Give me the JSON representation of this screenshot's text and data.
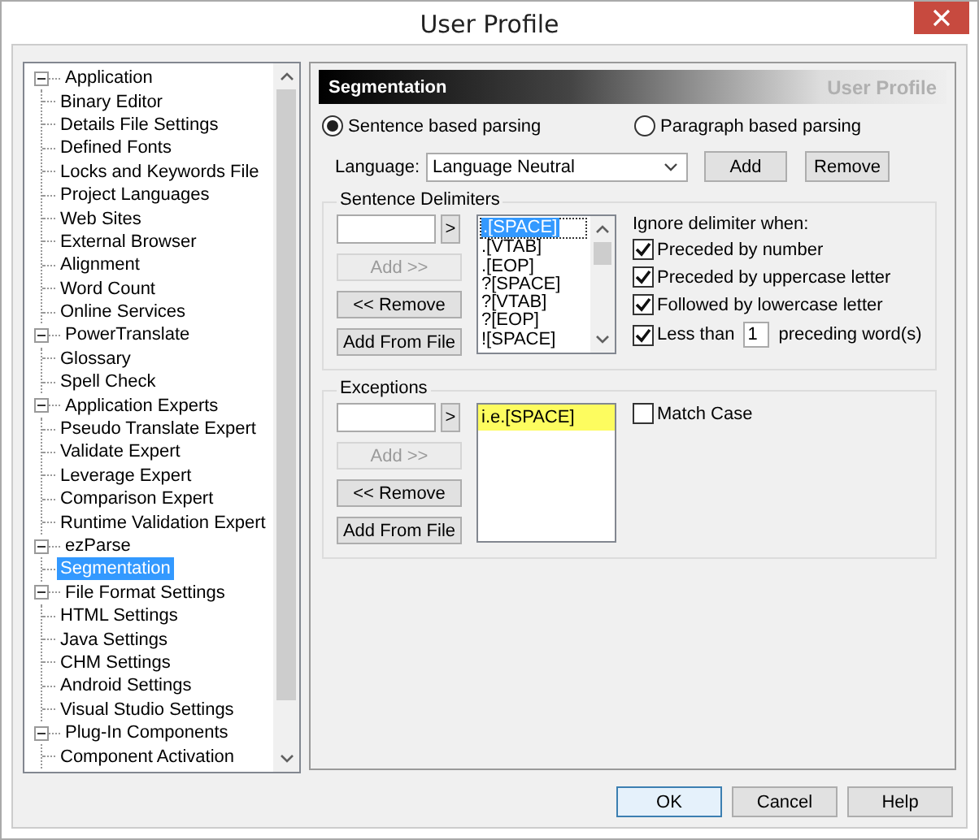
{
  "window": {
    "title": "User Profile"
  },
  "tree": {
    "items": [
      {
        "label": "Application",
        "expanded": true,
        "selected": false,
        "children": [
          {
            "label": "Binary Editor",
            "selected": false
          },
          {
            "label": "Details File Settings",
            "selected": false
          },
          {
            "label": "Defined Fonts",
            "selected": false
          },
          {
            "label": "Locks and Keywords File",
            "selected": false
          },
          {
            "label": "Project Languages",
            "selected": false
          },
          {
            "label": "Web Sites",
            "selected": false
          },
          {
            "label": "External Browser",
            "selected": false
          },
          {
            "label": "Alignment",
            "selected": false
          },
          {
            "label": "Word Count",
            "selected": false
          },
          {
            "label": "Online Services",
            "selected": false
          }
        ]
      },
      {
        "label": "PowerTranslate",
        "expanded": true,
        "selected": false,
        "children": [
          {
            "label": "Glossary",
            "selected": false
          },
          {
            "label": "Spell Check",
            "selected": false
          }
        ]
      },
      {
        "label": "Application Experts",
        "expanded": true,
        "selected": false,
        "children": [
          {
            "label": "Pseudo Translate Expert",
            "selected": false
          },
          {
            "label": "Validate Expert",
            "selected": false
          },
          {
            "label": "Leverage Expert",
            "selected": false
          },
          {
            "label": "Comparison Expert",
            "selected": false
          },
          {
            "label": "Runtime Validation Expert",
            "selected": false
          }
        ]
      },
      {
        "label": "ezParse",
        "expanded": true,
        "selected": false,
        "children": [
          {
            "label": "Segmentation",
            "selected": true
          }
        ]
      },
      {
        "label": "File Format Settings",
        "expanded": true,
        "selected": false,
        "children": [
          {
            "label": "HTML Settings",
            "selected": false
          },
          {
            "label": "Java Settings",
            "selected": false
          },
          {
            "label": "CHM Settings",
            "selected": false
          },
          {
            "label": "Android Settings",
            "selected": false
          },
          {
            "label": "Visual Studio Settings",
            "selected": false
          }
        ]
      },
      {
        "label": "Plug-In Components",
        "expanded": true,
        "selected": false,
        "children": [
          {
            "label": "Component Activation",
            "selected": false
          }
        ]
      }
    ]
  },
  "panel": {
    "title": "Segmentation",
    "subtitle": "User Profile",
    "parsing": [
      {
        "label": "Sentence based parsing",
        "selected": true
      },
      {
        "label": "Paragraph based parsing",
        "selected": false
      }
    ],
    "language": {
      "label": "Language:",
      "value": "Language Neutral",
      "buttons": [
        "Add",
        "Remove"
      ]
    },
    "groups": [
      {
        "title": "Sentence Delimiters",
        "arrow": ">",
        "buttons": [
          {
            "label": "Add >>",
            "disabled": true
          },
          {
            "label": "<< Remove",
            "disabled": false
          },
          {
            "label": "Add From File",
            "disabled": false
          }
        ],
        "list": [
          {
            "text": ".[SPACE]",
            "selected": true,
            "highlighted": false
          },
          {
            "text": ".[VTAB]",
            "selected": false,
            "highlighted": false
          },
          {
            "text": ".[EOP]",
            "selected": false,
            "highlighted": false
          },
          {
            "text": "?[SPACE]",
            "selected": false,
            "highlighted": false
          },
          {
            "text": "?[VTAB]",
            "selected": false,
            "highlighted": false
          },
          {
            "text": "?[EOP]",
            "selected": false,
            "highlighted": false
          },
          {
            "text": "![SPACE]",
            "selected": false,
            "highlighted": false
          }
        ],
        "scrollable": true,
        "options_label": "Ignore delimiter when:",
        "options": [
          {
            "kind": "check",
            "label": "Preceded by number",
            "checked": true
          },
          {
            "kind": "check",
            "label": "Preceded by uppercase letter",
            "checked": true
          },
          {
            "kind": "check",
            "label": "Followed by lowercase letter",
            "checked": true
          },
          {
            "kind": "count",
            "label": "Less than",
            "checked": true,
            "value": "1",
            "suffix": "preceding word(s)"
          }
        ]
      },
      {
        "title": "Exceptions",
        "arrow": ">",
        "buttons": [
          {
            "label": "Add >>",
            "disabled": true
          },
          {
            "label": "<< Remove",
            "disabled": false
          },
          {
            "label": "Add From File",
            "disabled": false
          }
        ],
        "list": [
          {
            "text": "i.e.[SPACE]",
            "selected": false,
            "highlighted": true
          }
        ],
        "scrollable": false,
        "options": [
          {
            "kind": "check",
            "label": "Match Case",
            "checked": false
          }
        ]
      }
    ]
  },
  "footer": {
    "buttons": [
      {
        "label": "OK",
        "focused": true
      },
      {
        "label": "Cancel",
        "focused": false
      },
      {
        "label": "Help",
        "focused": false
      }
    ]
  }
}
